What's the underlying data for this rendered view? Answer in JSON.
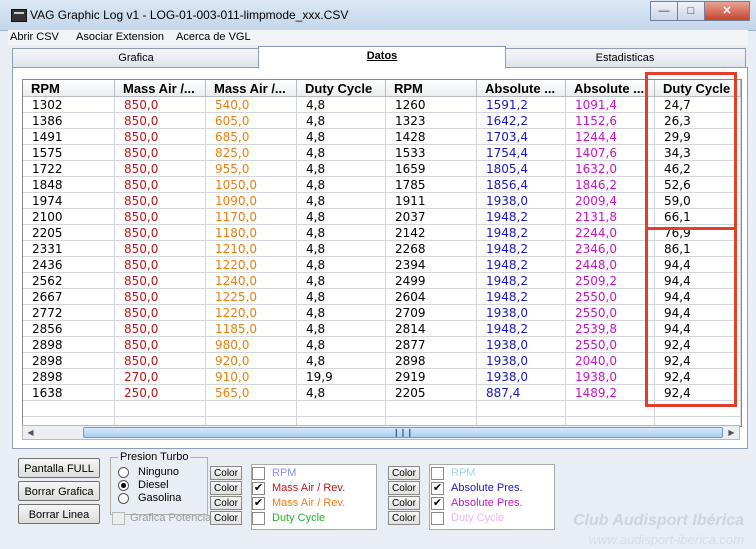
{
  "window": {
    "title": "VAG Graphic Log  v1 -  LOG-01-003-011-limpmode_xxx.CSV"
  },
  "menu": [
    "Abrir CSV",
    "Asociar Extension",
    "Acerca de VGL"
  ],
  "tabs": [
    {
      "label": "Grafica",
      "active": false
    },
    {
      "label": "Datos",
      "active": true
    },
    {
      "label": "Estadisticas",
      "active": false
    }
  ],
  "table": {
    "columns": [
      {
        "label": "RPM",
        "color": "#000000"
      },
      {
        "label": "Mass Air /...",
        "color": "#c41414"
      },
      {
        "label": "Mass Air /...",
        "color": "#f07d0c"
      },
      {
        "label": "Duty Cycle",
        "color": "#000000"
      },
      {
        "label": "RPM",
        "color": "#000000"
      },
      {
        "label": "Absolute ...",
        "color": "#1616c8"
      },
      {
        "label": "Absolute ...",
        "color": "#c814c8"
      },
      {
        "label": "Duty Cycle",
        "color": "#000000"
      }
    ],
    "rows": [
      [
        "1302",
        "850,0",
        "540,0",
        "4,8",
        "1260",
        "1591,2",
        "1091,4",
        "24,7"
      ],
      [
        "1386",
        "850,0",
        "605,0",
        "4,8",
        "1323",
        "1642,2",
        "1152,6",
        "26,3"
      ],
      [
        "1491",
        "850,0",
        "685,0",
        "4,8",
        "1428",
        "1703,4",
        "1244,4",
        "29,9"
      ],
      [
        "1575",
        "850,0",
        "825,0",
        "4,8",
        "1533",
        "1754,4",
        "1407,6",
        "34,3"
      ],
      [
        "1722",
        "850,0",
        "955,0",
        "4,8",
        "1659",
        "1805,4",
        "1632,0",
        "46,2"
      ],
      [
        "1848",
        "850,0",
        "1050,0",
        "4,8",
        "1785",
        "1856,4",
        "1846,2",
        "52,6"
      ],
      [
        "1974",
        "850,0",
        "1090,0",
        "4,8",
        "1911",
        "1938,0",
        "2009,4",
        "59,0"
      ],
      [
        "2100",
        "850,0",
        "1170,0",
        "4,8",
        "2037",
        "1948,2",
        "2131,8",
        "66,1"
      ],
      [
        "2205",
        "850,0",
        "1180,0",
        "4,8",
        "2142",
        "1948,2",
        "2244,0",
        "76,9"
      ],
      [
        "2331",
        "850,0",
        "1210,0",
        "4,8",
        "2268",
        "1948,2",
        "2346,0",
        "86,1"
      ],
      [
        "2436",
        "850,0",
        "1220,0",
        "4,8",
        "2394",
        "1948,2",
        "2448,0",
        "94,4"
      ],
      [
        "2562",
        "850,0",
        "1240,0",
        "4,8",
        "2499",
        "1948,2",
        "2509,2",
        "94,4"
      ],
      [
        "2667",
        "850,0",
        "1225,0",
        "4,8",
        "2604",
        "1948,2",
        "2550,0",
        "94,4"
      ],
      [
        "2772",
        "850,0",
        "1220,0",
        "4,8",
        "2709",
        "1938,0",
        "2550,0",
        "94,4"
      ],
      [
        "2856",
        "850,0",
        "1185,0",
        "4,8",
        "2814",
        "1948,2",
        "2539,8",
        "94,4"
      ],
      [
        "2898",
        "850,0",
        "980,0",
        "4,8",
        "2877",
        "1938,0",
        "2550,0",
        "92,4"
      ],
      [
        "2898",
        "850,0",
        "920,0",
        "4,8",
        "2898",
        "1938,0",
        "2040,0",
        "92,4"
      ],
      [
        "2898",
        "270,0",
        "910,0",
        "19,9",
        "2919",
        "1938,0",
        "1938,0",
        "92,4"
      ],
      [
        "1638",
        "250,0",
        "565,0",
        "4,8",
        "2205",
        "887,4",
        "1489,2",
        "92,4"
      ]
    ]
  },
  "buttons": {
    "full": "Pantalla  FULL",
    "clear_chart": "Borrar Grafica",
    "clear_line": "Borrar Linea"
  },
  "turbo": {
    "title": "Presion Turbo",
    "options": [
      "Ninguno",
      "Diesel",
      "Gasolina"
    ],
    "selected": "Diesel"
  },
  "potencia_label": "Grafica Potencia",
  "color_button": "Color",
  "legend_left": [
    {
      "label": "RPM",
      "checked": false,
      "color": "#8c8cf0"
    },
    {
      "label": "Mass Air / Rev.",
      "checked": true,
      "color": "#c41414"
    },
    {
      "label": "Mass Air / Rev.",
      "checked": true,
      "color": "#f07d0c"
    },
    {
      "label": "Duty Cycle",
      "checked": false,
      "color": "#23b423"
    }
  ],
  "legend_right": [
    {
      "label": "RPM",
      "checked": false,
      "color": "#9fd6f4"
    },
    {
      "label": "Absolute Pres.",
      "checked": true,
      "color": "#1616c8"
    },
    {
      "label": "Absolute Pres.",
      "checked": true,
      "color": "#c814c8"
    },
    {
      "label": "Duty Cycle",
      "checked": false,
      "color": "#f0b4f0"
    }
  ],
  "watermark": {
    "brand": "Club Audisport Ibérica",
    "url": "www.audisport-iberica.com"
  }
}
